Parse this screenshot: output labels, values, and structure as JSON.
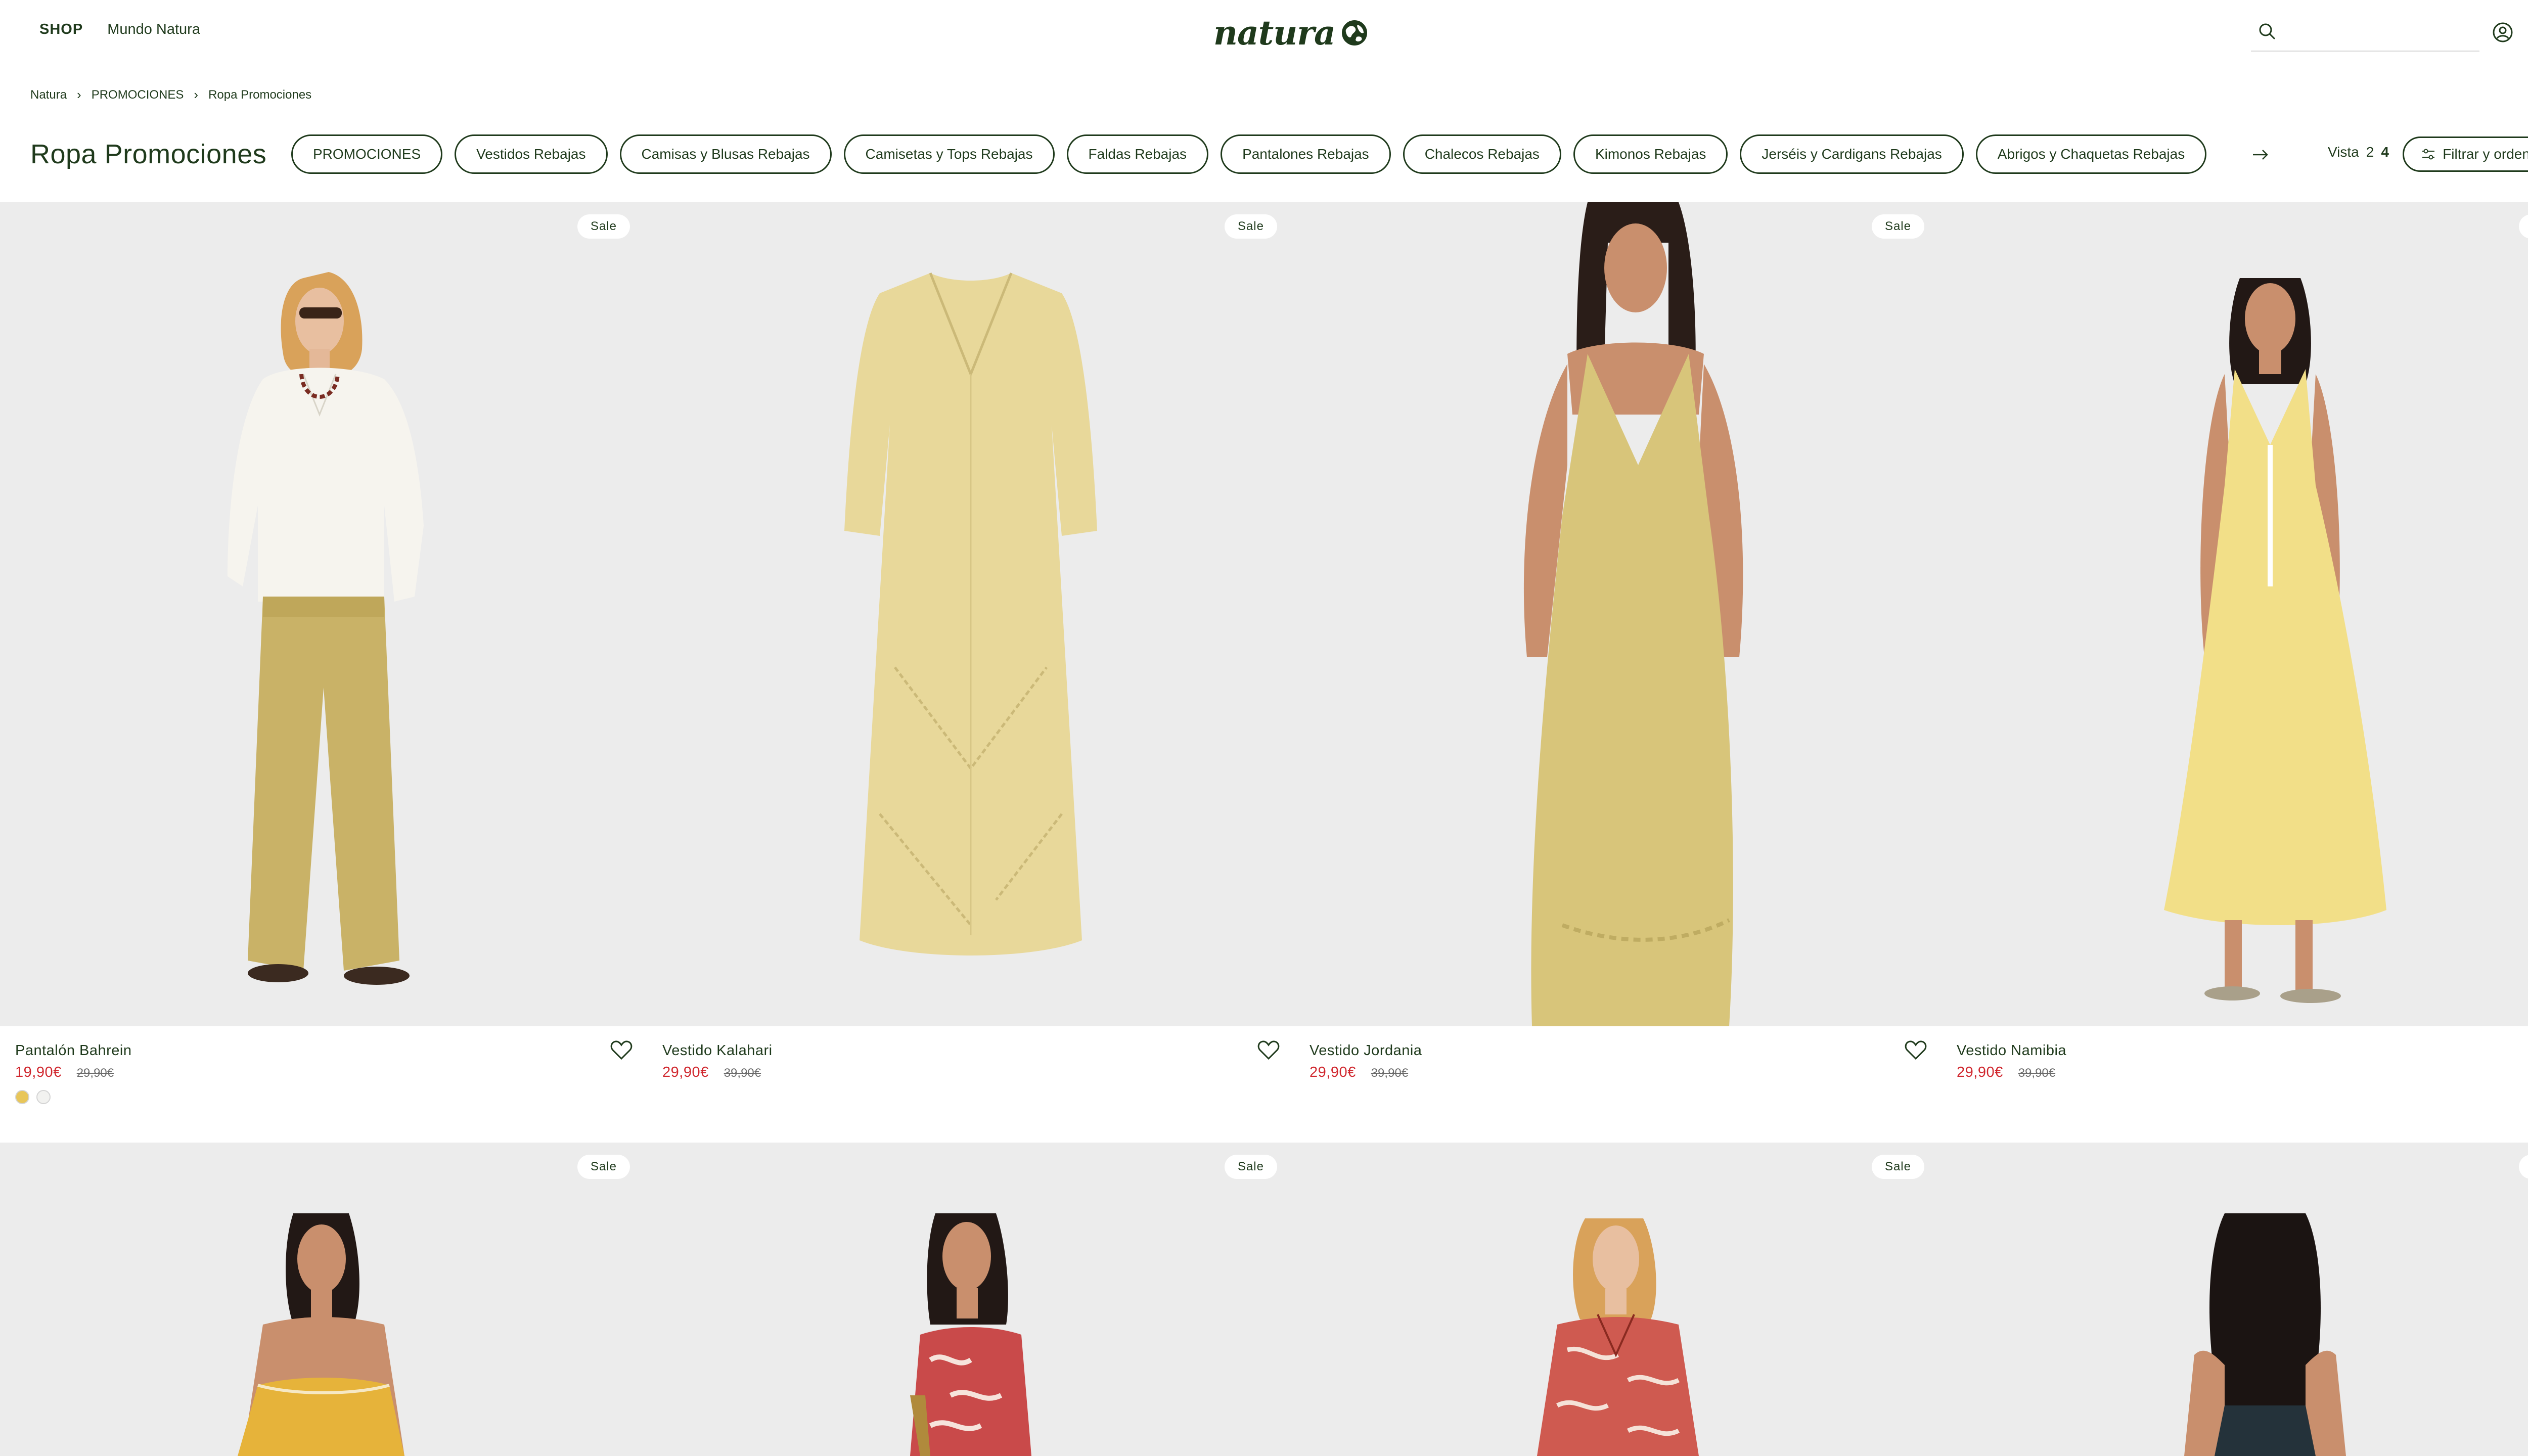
{
  "header": {
    "nav": [
      "SHOP",
      "Mundo Natura"
    ],
    "logo_text": "natura",
    "search": {
      "value": "",
      "placeholder": ""
    }
  },
  "breadcrumb": [
    "Natura",
    "PROMOCIONES",
    "Ropa Promociones"
  ],
  "title": "Ropa Promociones",
  "chips": [
    "PROMOCIONES",
    "Vestidos Rebajas",
    "Camisas y Blusas Rebajas",
    "Camisetas y Tops Rebajas",
    "Faldas Rebajas",
    "Pantalones Rebajas",
    "Chalecos Rebajas",
    "Kimonos Rebajas",
    "Jerséis y Cardigans Rebajas",
    "Abrigos y Chaquetas Rebajas"
  ],
  "view": {
    "label": "Vista",
    "options": [
      "2",
      "4"
    ],
    "active": "4"
  },
  "filter_label": "Filtrar y ordenar",
  "sale_label": "Sale",
  "products": [
    {
      "name": "Pantalón Bahrein",
      "price": "19,90€",
      "old_price": "29,90€",
      "swatches": [
        "#e8c65a",
        "#f2f2f0"
      ]
    },
    {
      "name": "Vestido Kalahari",
      "price": "29,90€",
      "old_price": "39,90€",
      "swatches": []
    },
    {
      "name": "Vestido Jordania",
      "price": "29,90€",
      "old_price": "39,90€",
      "swatches": []
    },
    {
      "name": "Vestido Namibia",
      "price": "29,90€",
      "old_price": "39,90€",
      "swatches": []
    }
  ],
  "colors": {
    "brand_green": "#1f3a1c",
    "sale_red": "#d0272e",
    "image_bg": "#ececec"
  }
}
